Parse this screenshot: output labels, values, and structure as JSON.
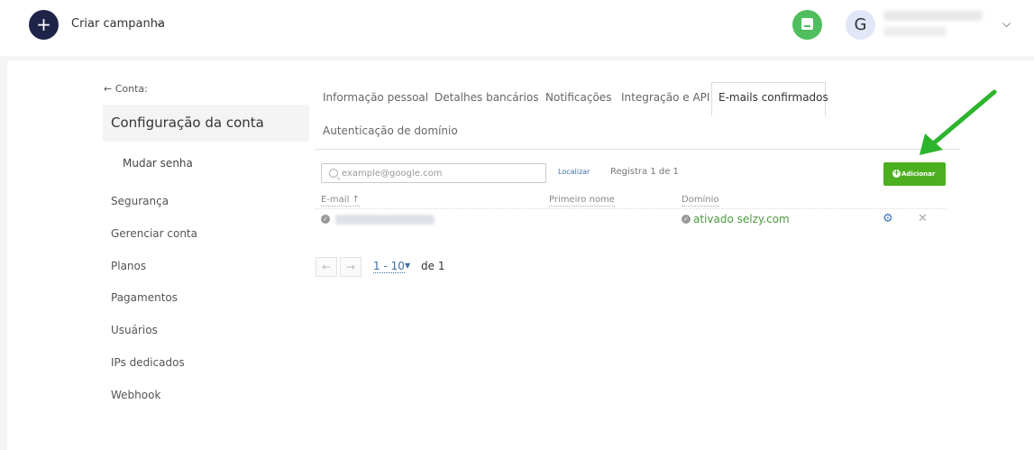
{
  "header": {
    "create_icon": "plus-icon",
    "create_label": "Criar campanha",
    "chat_icon": "chat-icon",
    "avatar_letter": "G",
    "accent_create": "#1e2347",
    "accent_chat": "#4fbe5f"
  },
  "sidebar": {
    "back_link": "← Conta:",
    "title": "Configuração da conta",
    "sub_item": "Mudar senha",
    "items": [
      "Segurança",
      "Gerenciar conta",
      "Planos",
      "Pagamentos",
      "Usuários",
      "IPs dedicados",
      "Webhook"
    ]
  },
  "tabs": {
    "items": [
      "Informação pessoal",
      "Detalhes bancários",
      "Notificações",
      "Integração e API",
      "E-mails confirmados",
      "Autenticação de domínio"
    ],
    "active": "E-mails confirmados"
  },
  "search": {
    "placeholder": "example@google.com",
    "find_label": "Localizar",
    "record_count": "Registra 1 de 1"
  },
  "add_button": {
    "label": "Adicionar",
    "color": "#4caf20"
  },
  "table": {
    "headers": [
      "E-mail ↑",
      "Primeiro nome",
      "Domínio"
    ],
    "rows": [
      {
        "email": "",
        "first_name": "",
        "domain_status": "ativado selzy.com"
      }
    ]
  },
  "pagination": {
    "range": "1 - 10",
    "of_label": "de 1"
  },
  "annotation": {
    "arrow_color": "#2cb52c"
  }
}
